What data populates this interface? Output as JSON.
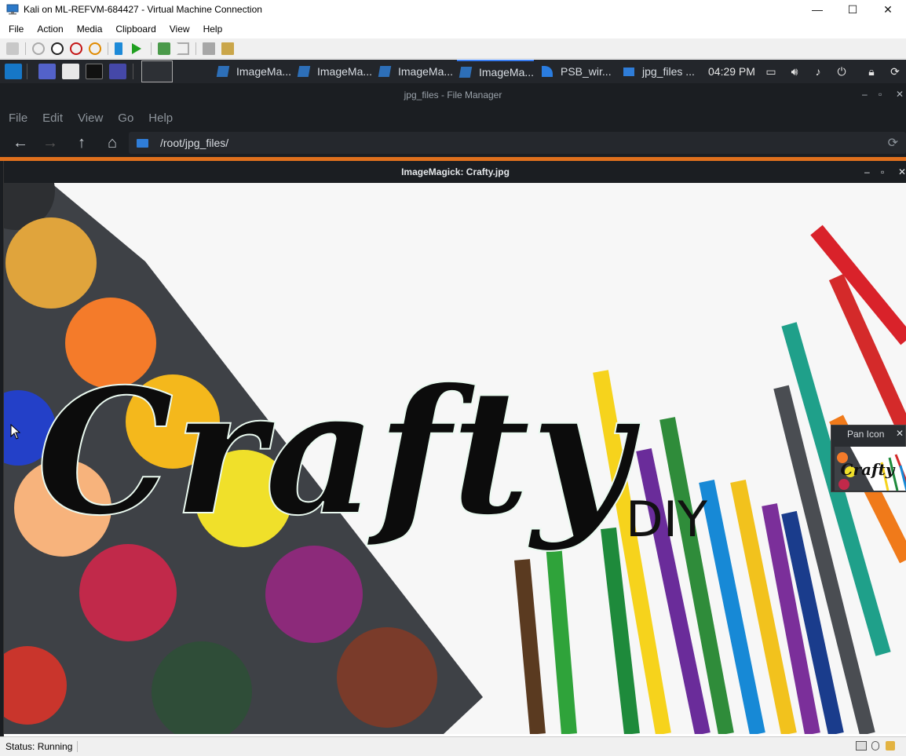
{
  "host": {
    "title": "Kali on ML-REFVM-684427 - Virtual Machine Connection",
    "menu": [
      "File",
      "Action",
      "Media",
      "Clipboard",
      "View",
      "Help"
    ],
    "controls": {
      "minimize": "—",
      "maximize": "☐",
      "close": "✕"
    },
    "status": "Status: Running"
  },
  "kali_panel": {
    "tasks": [
      "ImageMa...",
      "ImageMa...",
      "ImageMa...",
      "ImageMa...",
      "PSB_wir...",
      "jpg_files ..."
    ],
    "clock": "04:29 PM"
  },
  "file_manager": {
    "title": "jpg_files - File Manager",
    "menu": [
      "File",
      "Edit",
      "View",
      "Go",
      "Help"
    ],
    "path": "/root/jpg_files/"
  },
  "imagemagick": {
    "title": "ImageMagick: Crafty.jpg",
    "image": {
      "headline": "Crafty",
      "sub": "DIY"
    }
  },
  "pan_icon": {
    "title": "Pan Icon",
    "close": "✕"
  },
  "colors": {
    "accent": "#367bf0",
    "orange": "#e0701d",
    "panel": "#23262b"
  }
}
